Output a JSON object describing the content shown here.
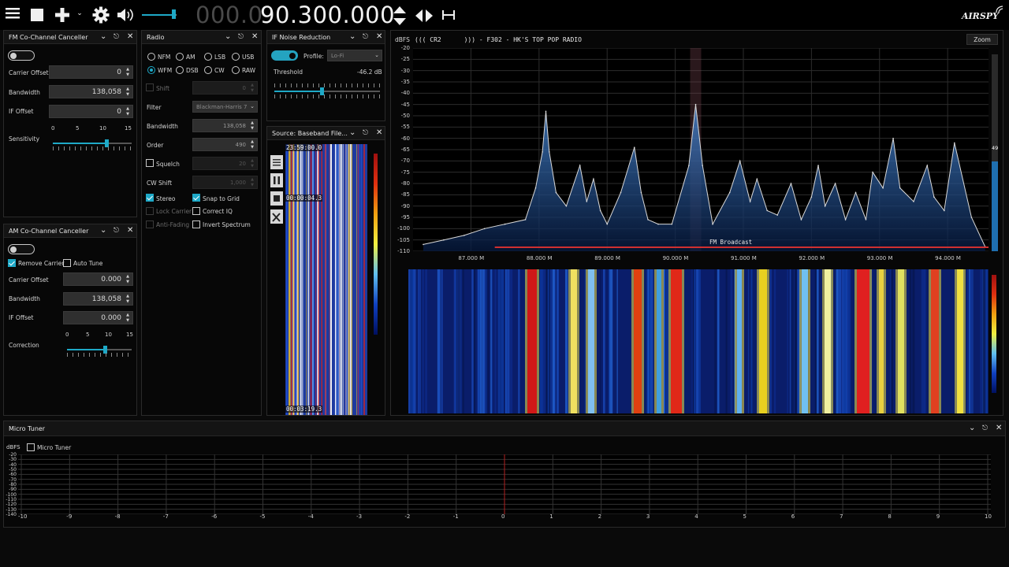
{
  "toolbar": {
    "freq_dim": "000.0",
    "freq_bright": "90.300.000",
    "brand": "AIRSPY"
  },
  "fm_cc": {
    "title": "FM Co-Channel Canceller",
    "carrier_offset_label": "Carrier Offset",
    "carrier_offset_value": "0",
    "bandwidth_label": "Bandwidth",
    "bandwidth_value": "138,058",
    "if_offset_label": "IF Offset",
    "if_offset_value": "0",
    "sensitivity_label": "Sensitivity",
    "scale": [
      "0",
      "5",
      "10",
      "15"
    ],
    "sensitivity_level": 0.68
  },
  "am_cc": {
    "title": "AM Co-Channel Canceller",
    "remove_carrier_label": "Remove Carrier",
    "auto_tune_label": "Auto Tune",
    "carrier_offset_label": "Carrier Offset",
    "carrier_offset_value": "0.000",
    "bandwidth_label": "Bandwidth",
    "bandwidth_value": "138,058",
    "if_offset_label": "IF Offset",
    "if_offset_value": "0.000",
    "correction_label": "Correction",
    "scale": [
      "0",
      "5",
      "10",
      "15"
    ],
    "correction_level": 0.58
  },
  "radio": {
    "title": "Radio",
    "modes_row1": [
      "NFM",
      "AM",
      "LSB",
      "USB"
    ],
    "modes_row2": [
      "WFM",
      "DSB",
      "CW",
      "RAW"
    ],
    "selected_mode": "WFM",
    "shift_label": "Shift",
    "shift_value": "0",
    "filter_label": "Filter",
    "filter_value": "Blackman-Harris 7",
    "bandwidth_label": "Bandwidth",
    "bandwidth_value": "138,058",
    "order_label": "Order",
    "order_value": "490",
    "squelch_label": "Squelch",
    "squelch_value": "20",
    "cw_shift_label": "CW Shift",
    "cw_shift_value": "1,000",
    "stereo_label": "Stereo",
    "snap_label": "Snap to Grid",
    "lock_carrier_label": "Lock Carrier",
    "correct_iq_label": "Correct IQ",
    "anti_fading_label": "Anti-Fading",
    "invert_label": "Invert Spectrum"
  },
  "ifnr": {
    "title": "IF Noise Reduction",
    "profile_label": "Profile:",
    "profile_value": "Lo-Fi",
    "threshold_label": "Threshold",
    "threshold_value": "-46.2 dB",
    "threshold_level": 0.45
  },
  "source": {
    "title": "Source: Baseband File...",
    "time_top": "23:59:00.0",
    "time_mid": "00:00:04.3",
    "time_bottom": "00:03:19.3"
  },
  "spectrum": {
    "dbfs_label": "dBFS",
    "rds": "((( CR2      ))) - F302 - HK'S TOP POP RADIO",
    "zoom_label": "Zoom",
    "band_label": "FM Broadcast",
    "level_value": "49",
    "y_ticks": [
      "-20",
      "-25",
      "-30",
      "-35",
      "-40",
      "-45",
      "-50",
      "-55",
      "-60",
      "-65",
      "-70",
      "-75",
      "-80",
      "-85",
      "-90",
      "-95",
      "-100",
      "-105",
      "-110"
    ],
    "x_ticks": [
      "87.000 M",
      "88.000 M",
      "89.000 M",
      "90.000 M",
      "91.000 M",
      "92.000 M",
      "93.000 M",
      "94.000 M"
    ]
  },
  "micro": {
    "title": "Micro Tuner",
    "dbfs_label": "dBFS",
    "checkbox_label": "Micro Tuner",
    "y_ticks": [
      "-20",
      "-30",
      "-40",
      "-50",
      "-60",
      "-70",
      "-80",
      "-90",
      "-100",
      "-110",
      "-120",
      "-130",
      "-140"
    ],
    "x_ticks": [
      "-10",
      "-9",
      "-8",
      "-7",
      "-6",
      "-5",
      "-4",
      "-3",
      "-2",
      "-1",
      "0",
      "1",
      "2",
      "3",
      "4",
      "5",
      "6",
      "7",
      "8",
      "9",
      "10"
    ]
  },
  "chart_data": {
    "type": "line",
    "xlabel": "",
    "ylabel": "dBFS",
    "xlim": [
      86.15,
      94.6
    ],
    "ylim": [
      -110,
      -20
    ],
    "x": [
      86.3,
      86.6,
      86.9,
      87.2,
      87.5,
      87.8,
      87.95,
      88.05,
      88.1,
      88.15,
      88.25,
      88.4,
      88.6,
      88.7,
      88.8,
      88.9,
      89.0,
      89.2,
      89.4,
      89.5,
      89.6,
      89.75,
      89.95,
      90.2,
      90.3,
      90.4,
      90.55,
      90.8,
      90.95,
      91.1,
      91.2,
      91.35,
      91.5,
      91.7,
      91.85,
      92.0,
      92.1,
      92.2,
      92.35,
      92.5,
      92.65,
      92.8,
      92.9,
      93.05,
      93.2,
      93.3,
      93.5,
      93.7,
      93.8,
      93.95,
      94.1,
      94.35,
      94.55
    ],
    "y": [
      -107,
      -105,
      -103,
      -100,
      -98,
      -96,
      -82,
      -66,
      -48,
      -66,
      -84,
      -90,
      -72,
      -88,
      -78,
      -92,
      -98,
      -84,
      -64,
      -84,
      -96,
      -98,
      -98,
      -72,
      -45,
      -72,
      -98,
      -84,
      -70,
      -88,
      -78,
      -92,
      -94,
      -80,
      -96,
      -86,
      -72,
      -90,
      -80,
      -96,
      -84,
      -96,
      -75,
      -82,
      -60,
      -82,
      -88,
      -72,
      -86,
      -92,
      -62,
      -95,
      -108
    ]
  }
}
